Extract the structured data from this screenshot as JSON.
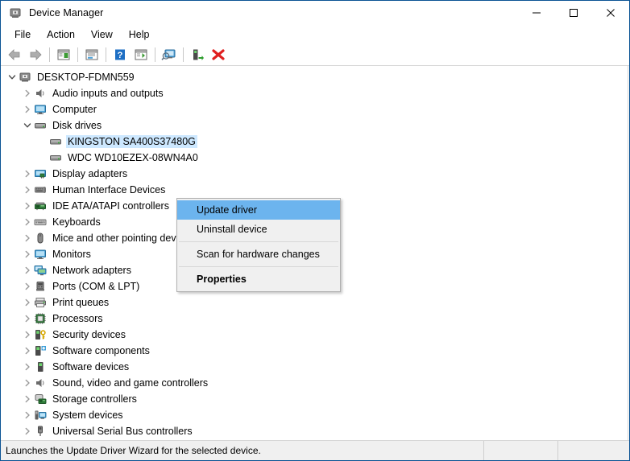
{
  "window": {
    "title": "Device Manager",
    "app_icon": "device-manager-icon",
    "border_color": "#0b5394",
    "controls": {
      "minimize": "minimize-icon",
      "maximize": "maximize-icon",
      "close": "close-icon"
    }
  },
  "menubar": {
    "items": [
      {
        "label": "File"
      },
      {
        "label": "Action"
      },
      {
        "label": "View"
      },
      {
        "label": "Help"
      }
    ]
  },
  "toolbar": {
    "buttons": [
      {
        "name": "back-icon",
        "title": "Back"
      },
      {
        "name": "forward-icon",
        "title": "Forward"
      },
      {
        "name": "separator",
        "title": ""
      },
      {
        "name": "show-hide-console-tree-icon",
        "title": "Show/Hide Console Tree"
      },
      {
        "name": "separator",
        "title": ""
      },
      {
        "name": "properties-icon",
        "title": "Properties"
      },
      {
        "name": "separator",
        "title": ""
      },
      {
        "name": "help-icon",
        "title": "Help"
      },
      {
        "name": "update-driver-icon",
        "title": "Update Driver"
      },
      {
        "name": "separator",
        "title": ""
      },
      {
        "name": "scan-for-hardware-changes-icon",
        "title": "Scan for hardware changes"
      },
      {
        "name": "separator",
        "title": ""
      },
      {
        "name": "enable-device-icon",
        "title": "Enable device"
      },
      {
        "name": "uninstall-device-icon",
        "title": "Uninstall device"
      }
    ]
  },
  "tree": {
    "nodes": [
      {
        "label": "DESKTOP-FDMN559",
        "depth": 0,
        "state": "expanded",
        "icon": "computer-root-icon",
        "selected": false
      },
      {
        "label": "Audio inputs and outputs",
        "depth": 1,
        "state": "collapsed",
        "icon": "speaker-icon",
        "selected": false
      },
      {
        "label": "Computer",
        "depth": 1,
        "state": "collapsed",
        "icon": "monitor-icon",
        "selected": false
      },
      {
        "label": "Disk drives",
        "depth": 1,
        "state": "expanded",
        "icon": "disk-drive-icon",
        "selected": false
      },
      {
        "label": "KINGSTON SA400S37480G",
        "depth": 2,
        "state": "leaf",
        "icon": "disk-drive-icon",
        "selected": true
      },
      {
        "label": "WDC WD10EZEX-08WN4A0",
        "depth": 2,
        "state": "leaf",
        "icon": "disk-drive-icon",
        "selected": false
      },
      {
        "label": "Display adapters",
        "depth": 1,
        "state": "collapsed",
        "icon": "display-adapter-icon",
        "selected": false
      },
      {
        "label": "Human Interface Devices",
        "depth": 1,
        "state": "collapsed",
        "icon": "hid-icon",
        "selected": false
      },
      {
        "label": "IDE ATA/ATAPI controllers",
        "depth": 1,
        "state": "collapsed",
        "icon": "ide-controller-icon",
        "selected": false
      },
      {
        "label": "Keyboards",
        "depth": 1,
        "state": "collapsed",
        "icon": "keyboard-icon",
        "selected": false
      },
      {
        "label": "Mice and other pointing devices",
        "depth": 1,
        "state": "collapsed",
        "icon": "mouse-icon",
        "selected": false
      },
      {
        "label": "Monitors",
        "depth": 1,
        "state": "collapsed",
        "icon": "monitor-icon",
        "selected": false
      },
      {
        "label": "Network adapters",
        "depth": 1,
        "state": "collapsed",
        "icon": "network-adapter-icon",
        "selected": false
      },
      {
        "label": "Ports (COM & LPT)",
        "depth": 1,
        "state": "collapsed",
        "icon": "port-icon",
        "selected": false
      },
      {
        "label": "Print queues",
        "depth": 1,
        "state": "collapsed",
        "icon": "printer-icon",
        "selected": false
      },
      {
        "label": "Processors",
        "depth": 1,
        "state": "collapsed",
        "icon": "processor-icon",
        "selected": false
      },
      {
        "label": "Security devices",
        "depth": 1,
        "state": "collapsed",
        "icon": "security-device-icon",
        "selected": false
      },
      {
        "label": "Software components",
        "depth": 1,
        "state": "collapsed",
        "icon": "software-component-icon",
        "selected": false
      },
      {
        "label": "Software devices",
        "depth": 1,
        "state": "collapsed",
        "icon": "software-device-icon",
        "selected": false
      },
      {
        "label": "Sound, video and game controllers",
        "depth": 1,
        "state": "collapsed",
        "icon": "speaker-icon",
        "selected": false
      },
      {
        "label": "Storage controllers",
        "depth": 1,
        "state": "collapsed",
        "icon": "storage-controller-icon",
        "selected": false
      },
      {
        "label": "System devices",
        "depth": 1,
        "state": "collapsed",
        "icon": "system-device-icon",
        "selected": false
      },
      {
        "label": "Universal Serial Bus controllers",
        "depth": 1,
        "state": "collapsed",
        "icon": "usb-icon",
        "selected": false
      }
    ]
  },
  "context_menu": {
    "highlight_color": "#6cb4ee",
    "items": [
      {
        "label": "Update driver",
        "highlighted": true,
        "bold": false,
        "separator_before": false
      },
      {
        "label": "Uninstall device",
        "highlighted": false,
        "bold": false,
        "separator_before": false
      },
      {
        "label": "Scan for hardware changes",
        "highlighted": false,
        "bold": false,
        "separator_before": true
      },
      {
        "label": "Properties",
        "highlighted": false,
        "bold": true,
        "separator_before": true
      }
    ]
  },
  "statusbar": {
    "message": "Launches the Update Driver Wizard for the selected device.",
    "pane2": "",
    "pane3": ""
  }
}
